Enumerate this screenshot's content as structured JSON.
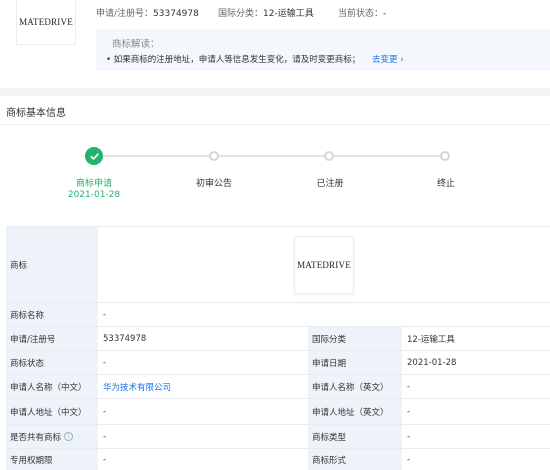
{
  "header": {
    "logo_text": "MATEDRIVE",
    "reg_no_label": "申请/注册号：",
    "reg_no_value": "53374978",
    "intl_class_label": "国际分类：",
    "intl_class_value": "12-运输工具",
    "status_label": "当前状态：",
    "status_value": "-"
  },
  "notice": {
    "title": "商标解读：",
    "body": "• 如果商标的注册地址，申请人等信息发生变化，请及时变更商标；",
    "link": "去变更 ›"
  },
  "section": {
    "title": "商标基本信息"
  },
  "timeline": {
    "steps": [
      {
        "label": "商标申请",
        "date": "2021-01-28",
        "done": true
      },
      {
        "label": "初审公告",
        "date": "",
        "done": false
      },
      {
        "label": "已注册",
        "date": "",
        "done": false
      },
      {
        "label": "终止",
        "date": "",
        "done": false
      }
    ]
  },
  "table": {
    "trademark_label": "商标",
    "trademark_image_text": "MATEDRIVE",
    "name_label": "商标名称",
    "name_value": "-",
    "reg_no_label": "申请/注册号",
    "reg_no_value": "53374978",
    "intl_class_label": "国际分类",
    "intl_class_value": "12-运输工具",
    "status_label": "商标状态",
    "status_value": "-",
    "apply_date_label": "申请日期",
    "apply_date_value": "2021-01-28",
    "applicant_cn_label": "申请人名称（中文）",
    "applicant_cn_value": "华为技术有限公司",
    "applicant_en_label": "申请人名称（英文）",
    "applicant_en_value": "-",
    "addr_cn_label": "申请人地址（中文）",
    "addr_cn_value": "-",
    "addr_en_label": "申请人地址（英文）",
    "addr_en_value": "-",
    "shared_label": "是否共有商标",
    "shared_value": "-",
    "type_label": "商标类型",
    "type_value": "-",
    "term_label": "专用权期限",
    "term_value": "-",
    "form_label": "商标形式",
    "form_value": "-"
  },
  "colors": {
    "accent_green": "#21b26b",
    "link_blue": "#1a72e8",
    "label_bg": "#eef3fa"
  },
  "icons": {
    "done": "check-icon",
    "info": "info-icon",
    "link_arrow": "chevron-right-icon"
  }
}
